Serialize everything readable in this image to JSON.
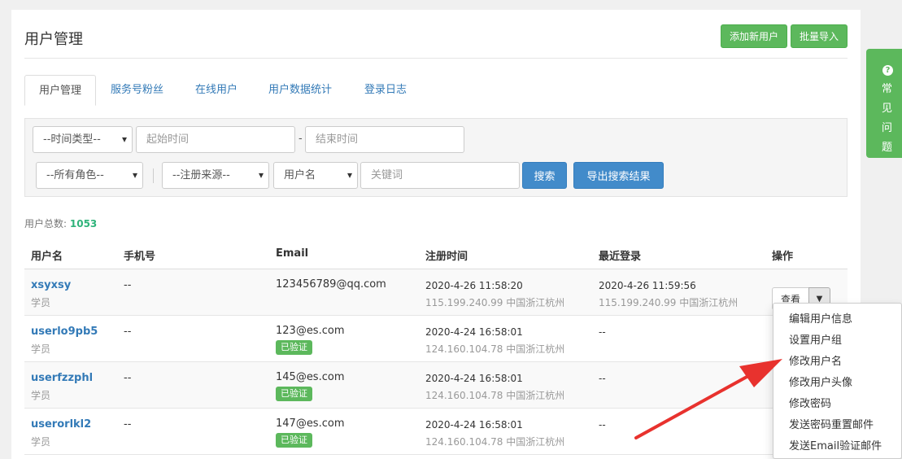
{
  "header": {
    "title": "用户管理",
    "add_user_label": "添加新用户",
    "batch_import_label": "批量导入"
  },
  "tabs": [
    {
      "label": "用户管理",
      "active": true
    },
    {
      "label": "服务号粉丝"
    },
    {
      "label": "在线用户"
    },
    {
      "label": "用户数据统计"
    },
    {
      "label": "登录日志"
    }
  ],
  "filters": {
    "time_type": "--时间类型--",
    "start_placeholder": "起始时间",
    "dash": "-",
    "end_placeholder": "结束时间",
    "role": "--所有角色--",
    "source": "--注册来源--",
    "field": "用户名",
    "keyword_placeholder": "关键词",
    "search_label": "搜索",
    "export_label": "导出搜索结果"
  },
  "summary": {
    "label": "用户总数:",
    "count": "1053"
  },
  "table": {
    "headers": [
      "用户名",
      "手机号",
      "Email",
      "注册时间",
      "最近登录",
      "操作"
    ],
    "rows": [
      {
        "username": "xsyxsy",
        "role": "学员",
        "phone": "--",
        "email": "123456789@qq.com",
        "verified": "",
        "reg_time": "2020-4-26 11:58:20",
        "reg_ip": "115.199.240.99 中国浙江杭州",
        "last_login": "2020-4-26 11:59:56",
        "last_ip": "115.199.240.99 中国浙江杭州"
      },
      {
        "username": "userlo9pb5",
        "role": "学员",
        "phone": "--",
        "email": "123@es.com",
        "verified": "已验证",
        "reg_time": "2020-4-24 16:58:01",
        "reg_ip": "124.160.104.78 中国浙江杭州",
        "last_login": "--",
        "last_ip": ""
      },
      {
        "username": "userfzzphl",
        "role": "学员",
        "phone": "--",
        "email": "145@es.com",
        "verified": "已验证",
        "reg_time": "2020-4-24 16:58:01",
        "reg_ip": "124.160.104.78 中国浙江杭州",
        "last_login": "--",
        "last_ip": ""
      },
      {
        "username": "userorlkl2",
        "role": "学员",
        "phone": "--",
        "email": "147@es.com",
        "verified": "已验证",
        "reg_time": "2020-4-24 16:58:01",
        "reg_ip": "124.160.104.78 中国浙江杭州",
        "last_login": "--",
        "last_ip": ""
      }
    ],
    "view_label": "查看"
  },
  "dropdown": {
    "items": [
      "编辑用户信息",
      "设置用户组",
      "修改用户名",
      "修改用户头像",
      "修改密码",
      "发送密码重置邮件",
      "发送Email验证邮件"
    ]
  },
  "help": {
    "icon": "?",
    "label": "常见问题"
  },
  "colors": {
    "green": "#5cb85c",
    "blue": "#428bca",
    "link": "#337ab7",
    "count": "#2fb37a",
    "arrow": "#e8322e"
  }
}
